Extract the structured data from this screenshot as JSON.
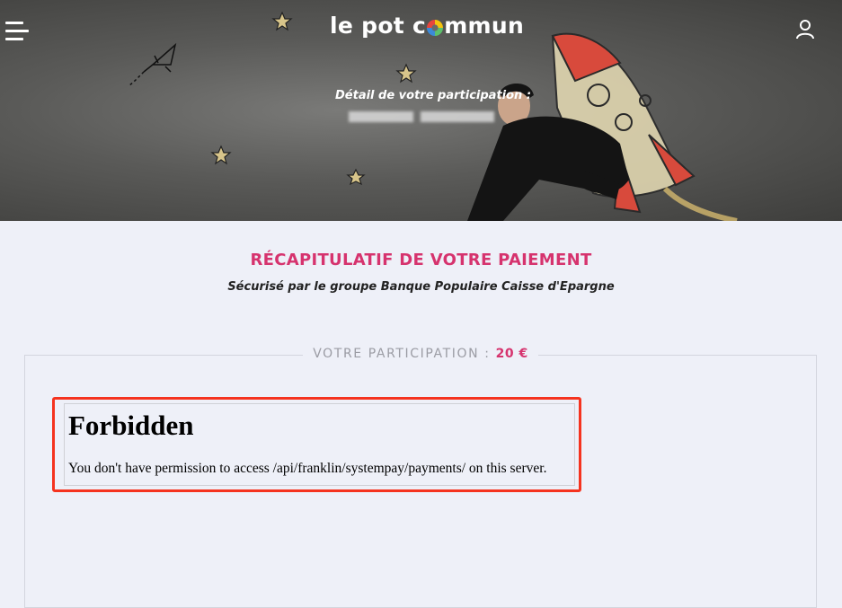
{
  "header": {
    "logo_prefix": "le pot c",
    "logo_suffix": "mmun",
    "subtitle": "Détail de votre participation :"
  },
  "icons": {
    "menu": "hamburger-menu-icon",
    "user": "user-icon",
    "logo_o": "multicolor-circle-icon"
  },
  "summary": {
    "title": "RÉCAPITULATIF DE VOTRE PAIEMENT",
    "subtitle": "Sécurisé par le groupe Banque Populaire Caisse d'Epargne"
  },
  "participation": {
    "label": "VOTRE PARTICIPATION :",
    "amount": "20 €"
  },
  "error": {
    "title": "Forbidden",
    "message": "You don't have permission to access /api/franklin/systempay/payments/ on this server."
  },
  "colors": {
    "accent": "#d6336e",
    "page_bg": "#eef0f8",
    "highlight": "#f5331f",
    "logo_o": [
      "#f4c20d",
      "#e8453c",
      "#3b8ad8",
      "#5cc06b"
    ]
  }
}
